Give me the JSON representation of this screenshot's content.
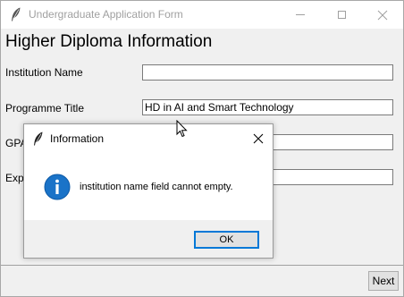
{
  "window": {
    "title": "Undergraduate Application Form",
    "icon": "feather-icon"
  },
  "form": {
    "heading": "Higher Diploma Information",
    "fields": [
      {
        "label": "Institution Name",
        "value": ""
      },
      {
        "label": "Programme Title",
        "value": "HD in AI and Smart Technology"
      },
      {
        "label": "GPA",
        "value": ""
      },
      {
        "label": "Expe",
        "value": ""
      }
    ],
    "next_label": "Next"
  },
  "dialog": {
    "title": "Information",
    "message": "institution name field cannot empty.",
    "ok_label": "OK",
    "icon": "info-icon",
    "accent": "#0078d7"
  }
}
